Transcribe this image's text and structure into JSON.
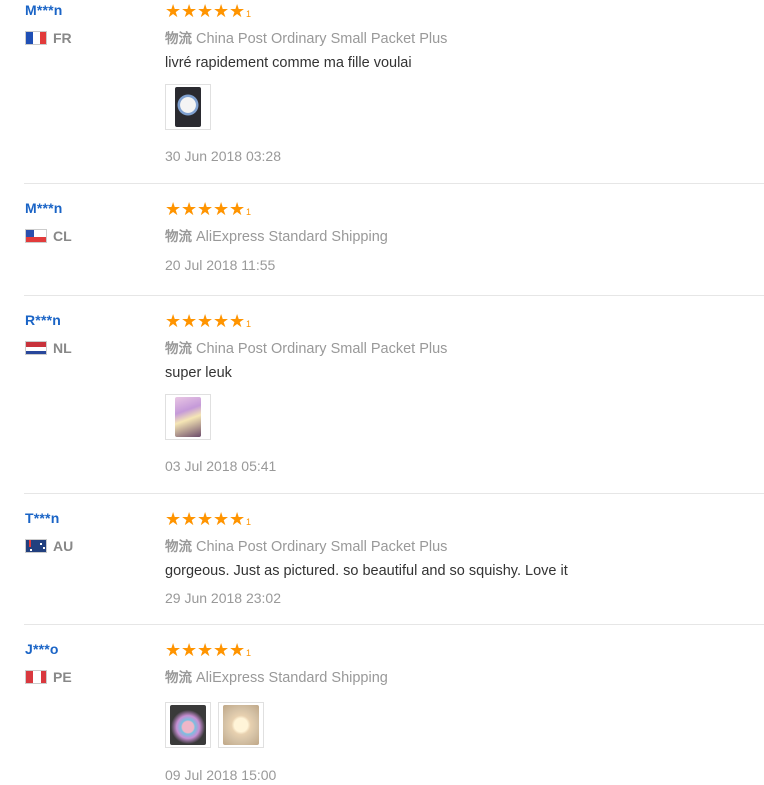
{
  "logistics_label": "物流",
  "rating_label": "1",
  "reviews": [
    {
      "user": "M***n",
      "country": "FR",
      "logistics": "China Post Ordinary Small Packet Plus",
      "feedback": "livré rapidement comme ma fille voulai",
      "photos": [
        "unicorn-squishy-photo"
      ],
      "date": "30 Jun 2018 03:28"
    },
    {
      "user": "M***n",
      "country": "CL",
      "logistics": "AliExpress Standard Shipping",
      "feedback": "",
      "photos": [],
      "date": "20 Jul 2018 11:55"
    },
    {
      "user": "R***n",
      "country": "NL",
      "logistics": "China Post Ordinary Small Packet Plus",
      "feedback": "super leuk",
      "photos": [
        "unicorn-squishy-photo"
      ],
      "date": "03 Jul 2018 05:41"
    },
    {
      "user": "T***n",
      "country": "AU",
      "logistics": "China Post Ordinary Small Packet Plus",
      "feedback": "gorgeous. Just as pictured. so beautiful and so squishy. Love it",
      "photos": [],
      "date": "29 Jun 2018 23:02"
    },
    {
      "user": "J***o",
      "country": "PE",
      "logistics": "AliExpress Standard Shipping",
      "feedback": "",
      "photos": [
        "unicorn-squishy-photo",
        "unicorn-squishy-photo"
      ],
      "date": "09 Jul 2018 15:00"
    }
  ],
  "colors": {
    "username": "#1a64c6",
    "star": "#ff9400",
    "muted": "#999999",
    "text": "#333333"
  }
}
